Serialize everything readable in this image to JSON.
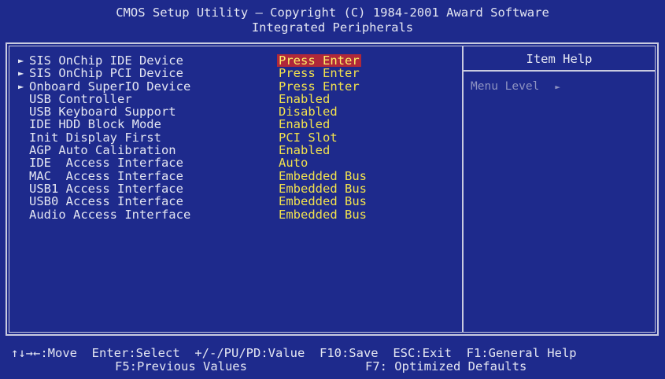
{
  "header": {
    "title_line1": "CMOS Setup Utility – Copyright (C) 1984-2001 Award Software",
    "title_line2": "Integrated Peripherals"
  },
  "settings": [
    {
      "submenu": true,
      "label": "SIS OnChip IDE Device",
      "value": "Press Enter",
      "selected": true
    },
    {
      "submenu": true,
      "label": "SIS OnChip PCI Device",
      "value": "Press Enter"
    },
    {
      "submenu": true,
      "label": "Onboard SuperIO Device",
      "value": "Press Enter"
    },
    {
      "submenu": false,
      "label": "USB Controller",
      "value": "Enabled"
    },
    {
      "submenu": false,
      "label": "USB Keyboard Support",
      "value": "Disabled"
    },
    {
      "submenu": false,
      "label": "IDE HDD Block Mode",
      "value": "Enabled"
    },
    {
      "submenu": false,
      "label": "Init Display First",
      "value": "PCI Slot"
    },
    {
      "submenu": false,
      "label": "AGP Auto Calibration",
      "value": "Enabled"
    },
    {
      "submenu": false,
      "label": "IDE  Access Interface",
      "value": "Auto"
    },
    {
      "submenu": false,
      "label": "MAC  Access Interface",
      "value": "Embedded Bus"
    },
    {
      "submenu": false,
      "label": "USB1 Access Interface",
      "value": "Embedded Bus"
    },
    {
      "submenu": false,
      "label": "USB0 Access Interface",
      "value": "Embedded Bus"
    },
    {
      "submenu": false,
      "label": "Audio Access Interface",
      "value": "Embedded Bus"
    }
  ],
  "item_help": {
    "title": "Item Help",
    "menu_level_label": "Menu Level",
    "menu_level_glyph": "►"
  },
  "submenu_glyph": "►",
  "footer": {
    "line1": {
      "move": "↑↓→←:Move",
      "select": "Enter:Select",
      "value": "+/-/PU/PD:Value",
      "save": "F10:Save",
      "exit": "ESC:Exit",
      "help": "F1:General Help"
    },
    "line2": {
      "previous": "F5:Previous Values",
      "optimized": "F7: Optimized Defaults"
    }
  },
  "colors": {
    "background": "#1e2a8c",
    "text": "#e4e6f2",
    "value_text": "#f2e24d",
    "highlight": "#b0283a",
    "help_text": "#8e93c2"
  }
}
